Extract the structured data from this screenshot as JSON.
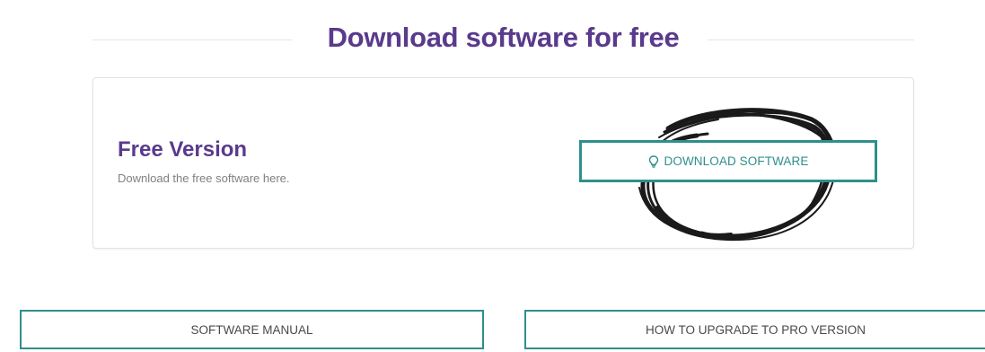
{
  "heading": {
    "title": "Download software for free"
  },
  "free_version_card": {
    "title": "Free Version",
    "description": "Download the free software here.",
    "download_button": {
      "icon": "lightbulb-icon",
      "label": "DOWNLOAD SOFTWARE"
    }
  },
  "bottom_buttons": {
    "manual_label": "SOFTWARE MANUAL",
    "upgrade_label": "HOW TO UPGRADE TO PRO VERSION"
  },
  "colors": {
    "heading": "#5a3a8c",
    "accent_teal": "#2e8f8c",
    "muted_text": "#808080",
    "scribble": "#1a1a1a"
  }
}
